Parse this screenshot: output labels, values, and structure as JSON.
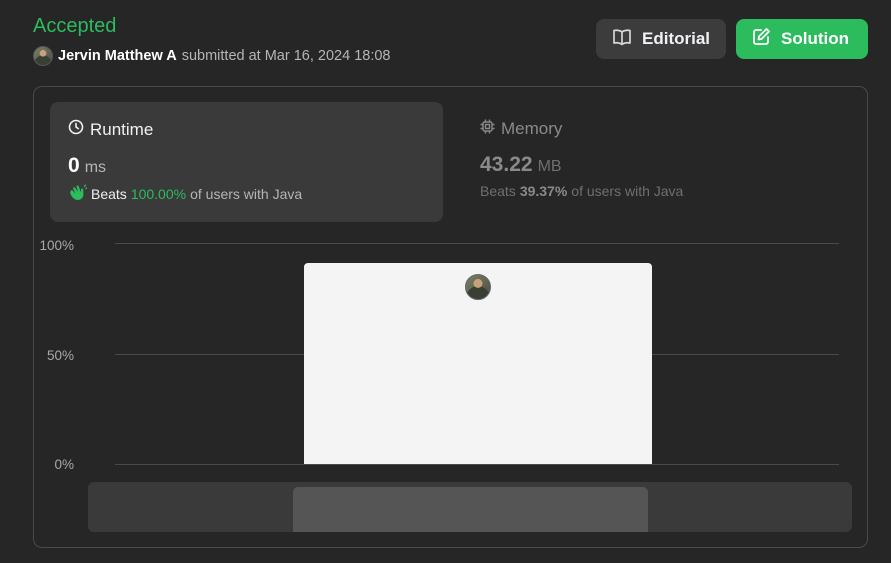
{
  "header": {
    "status": "Accepted",
    "submitter_name": "Jervin Matthew A",
    "submitted_text": "submitted at Mar 16, 2024 18:08"
  },
  "buttons": {
    "editorial": "Editorial",
    "solution": "Solution"
  },
  "runtime": {
    "title": "Runtime",
    "value": "0",
    "unit": "ms",
    "beats_label": "Beats",
    "beats_pct": "100.00%",
    "beats_suffix": "of users with Java"
  },
  "memory": {
    "title": "Memory",
    "value": "43.22",
    "unit": "MB",
    "beats_label": "Beats",
    "beats_pct": "39.37%",
    "beats_suffix": "of users with Java"
  },
  "chart_data": {
    "type": "bar",
    "y_ticks": [
      "100%",
      "50%",
      "0%"
    ],
    "ylim": [
      0,
      100
    ],
    "bars": [
      {
        "value": 91
      }
    ]
  },
  "colors": {
    "accent_green": "#2cbb5d",
    "background": "#262626"
  },
  "icons": {
    "editorial": "book-icon",
    "solution": "edit-icon",
    "runtime": "clock-icon",
    "memory": "chip-icon",
    "beats": "clap-icon"
  }
}
